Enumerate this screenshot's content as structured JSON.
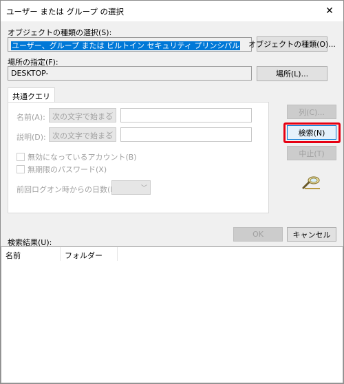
{
  "window": {
    "title": "ユーザー または グループ の選択",
    "close_glyph": "✕"
  },
  "object_type": {
    "label": "オブジェクトの種類の選択(S):",
    "value": "ユーザー、グループ または ビルトイン セキュリティ プリンシパル",
    "button": "オブジェクトの種類(O)..."
  },
  "location": {
    "label": "場所の指定(F):",
    "value": "DESKTOP-",
    "button": "場所(L)..."
  },
  "tab": {
    "label": "共通クエリ"
  },
  "query": {
    "name_label": "名前(A):",
    "name_mode": "次の文字で始まる",
    "desc_label": "説明(D):",
    "desc_mode": "次の文字で始まる",
    "disabled_accounts": "無効になっているアカウント(B)",
    "no_expire_password": "無期限のパスワード(X)",
    "days_since_logon": "前回ログオン時からの日数(I):",
    "dropdown_arrow": "﹀"
  },
  "buttons": {
    "columns": "列(C)...",
    "search": "検索(N)",
    "stop": "中止(T)",
    "ok": "OK",
    "cancel": "キャンセル"
  },
  "results": {
    "label": "検索結果(U):",
    "columns": [
      "名前",
      "フォルダー"
    ]
  },
  "icons": {
    "search_icon": "magnifier-icon"
  },
  "colors": {
    "accent": "#0078d7",
    "highlight_frame": "#e60012"
  }
}
